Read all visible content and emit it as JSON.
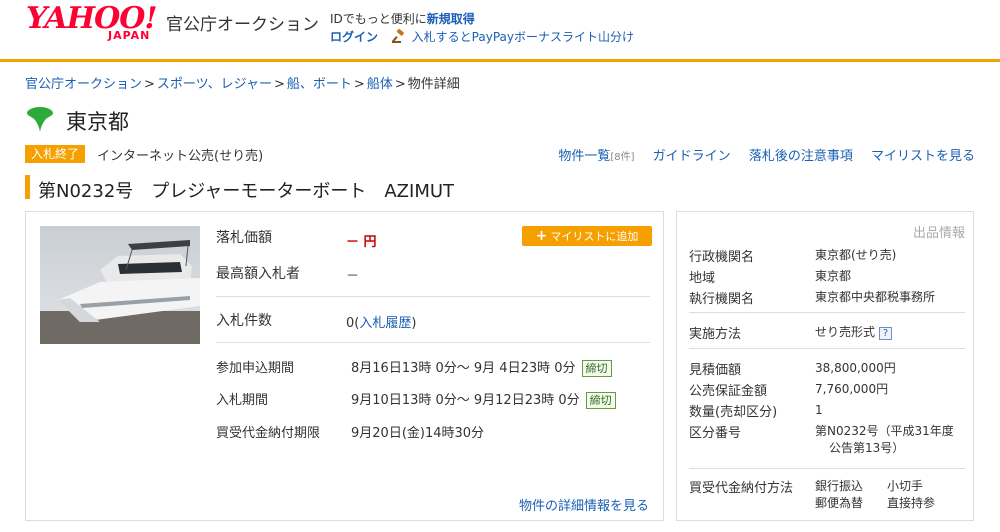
{
  "header": {
    "logo_main": "YAHOO!",
    "logo_sub": "JAPAN",
    "service_name": "官公庁オークション",
    "id_prompt": "IDでもっと便利に",
    "register_label": "新規取得",
    "login_label": "ログイン",
    "bid_bonus_label": "入札するとPayPayボーナスライト山分け"
  },
  "breadcrumb": {
    "items": [
      "官公庁オークション",
      "スポーツ、レジャー",
      "船、ボート",
      "船体"
    ],
    "current": "物件詳細",
    "separator": ">"
  },
  "org": {
    "name": "東京都"
  },
  "status": {
    "badge": "入札終了",
    "sale_type": "インターネット公売(せり売)"
  },
  "top_links": {
    "item_list": "物件一覧",
    "item_count": "[8件]",
    "guideline": "ガイドライン",
    "after_win": "落札後の注意事項",
    "mylist": "マイリストを見る"
  },
  "item": {
    "title": "第N0232号　プレジャーモーターボート　AZIMUT"
  },
  "main": {
    "price_label": "落札価額",
    "price_value": "－ 円",
    "mylist_button": "マイリストに追加",
    "top_bidder_label": "最高額入札者",
    "top_bidder_value": "－",
    "bid_count_label": "入札件数",
    "bid_count_value": "0",
    "bid_history_link": "入札履歴",
    "apply_period_label": "参加申込期間",
    "apply_period_value": "8月16日13時 0分～ 9月 4日23時 0分",
    "bid_period_label": "入札期間",
    "bid_period_value": "9月10日13時 0分～ 9月12日23時 0分",
    "closed_tag": "締切",
    "payment_deadline_label": "買受代金納付期限",
    "payment_deadline_value": "9月20日(金)14時30分",
    "detail_link": "物件の詳細情報を見る"
  },
  "side": {
    "header": "出品情報",
    "rows": [
      {
        "label": "行政機関名",
        "value": "東京都(せり売)"
      },
      {
        "label": "地域",
        "value": "東京都"
      },
      {
        "label": "執行機関名",
        "value": "東京都中央都税事務所"
      },
      {
        "label": "実施方法",
        "value": "せり売形式"
      },
      {
        "label": "見積価額",
        "value": "38,800,000円"
      },
      {
        "label": "公売保証金額",
        "value": "7,760,000円"
      },
      {
        "label": "数量(売却区分)",
        "value": "1"
      },
      {
        "label": "区分番号",
        "value": "第N0232号（平成31年度",
        "value2": "公告第13号）"
      },
      {
        "label": "買受代金納付方法",
        "value": "銀行振込　　小切手",
        "value2": "郵便為替　　直接持参"
      }
    ],
    "help_icon": "?"
  },
  "colors": {
    "accent": "#f5a000",
    "link": "#1a5fb4",
    "brand": "#ff0033",
    "org_green": "#2eaa3a"
  },
  "icons": {
    "gavel": "gavel-icon",
    "help": "help-icon",
    "plus": "plus-icon",
    "org_logo": "tokyo-ginkgo-icon"
  }
}
